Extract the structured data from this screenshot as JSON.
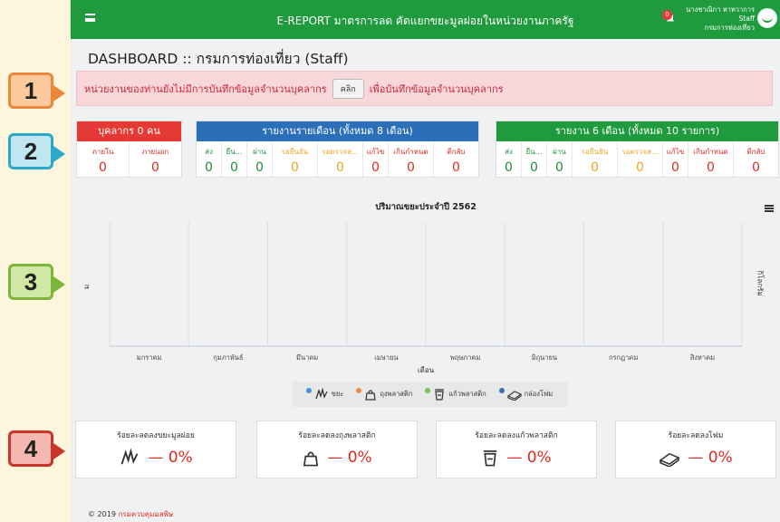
{
  "callouts": [
    "1",
    "2",
    "3",
    "4"
  ],
  "header": {
    "title": "E-REPORT มาตรการลด คัดแยกขยะมูลฝอยในหน่วยงานภาครัฐ",
    "notification_count": "0",
    "user_name": "นางชาณิกา หาทวาการ",
    "user_role": "Staff",
    "user_org": "กรมการท่องเที่ยว"
  },
  "page_title": "DASHBOARD :: กรมการท่องเที่ยว (Staff)",
  "alert": {
    "text_before": "หน่วยงานของท่านยังไม่มีการบันทึกข้อมูลจำนวนบุคลากร",
    "button_label": "คลิก",
    "text_after": "เพื่อบันทึกข้อมูลจำนวนบุคลากร"
  },
  "personnel": {
    "title": "บุคลากร 0 คน",
    "color": "#e53935",
    "cols": [
      {
        "label": "ภายใน",
        "value": "0"
      },
      {
        "label": "ภายนอก",
        "value": "0"
      }
    ]
  },
  "monthly": {
    "title": "รายงานรายเดือน (ทั้งหมด 8 เดือน)",
    "color": "#2b6fb8",
    "cols": [
      {
        "label": "ส่ง",
        "value": "0",
        "c": "gr"
      },
      {
        "label": "ยืน...",
        "value": "0",
        "c": "gr"
      },
      {
        "label": "ผ่าน",
        "value": "0",
        "c": "gr"
      },
      {
        "label": "รอยืนยัน",
        "value": "0",
        "c": "or"
      },
      {
        "label": "รอตรวจส...",
        "value": "0",
        "c": "or"
      },
      {
        "label": "แก้ไข",
        "value": "0",
        "c": "red"
      },
      {
        "label": "เกินกำหนด",
        "value": "0",
        "c": "red"
      },
      {
        "label": "ตีกลับ",
        "value": "0",
        "c": "red"
      }
    ]
  },
  "six_month": {
    "title": "รายงาน 6 เดือน (ทั้งหมด 10 รายการ)",
    "color": "#1f9b3d",
    "cols": [
      {
        "label": "ส่ง",
        "value": "0",
        "c": "gr"
      },
      {
        "label": "ยืน...",
        "value": "0",
        "c": "gr"
      },
      {
        "label": "ผ่าน",
        "value": "0",
        "c": "gr"
      },
      {
        "label": "รอยืนยัน",
        "value": "0",
        "c": "or"
      },
      {
        "label": "รอตรวจส...",
        "value": "0",
        "c": "or"
      },
      {
        "label": "แก้ไข",
        "value": "0",
        "c": "red"
      },
      {
        "label": "เกินกำหนด",
        "value": "0",
        "c": "red"
      },
      {
        "label": "ตีกลับ",
        "value": "0",
        "c": "red"
      }
    ]
  },
  "chart_data": {
    "type": "bar",
    "title": "ปริมาณขยะประจำปี 2562",
    "xlabel": "เดือน",
    "ylabel_left": "ม",
    "ylabel_right": "กิโลกรัม",
    "categories": [
      "มกราคม",
      "กุมภาพันธ์",
      "มีนาคม",
      "เมษายน",
      "พฤษภาคม",
      "มิถุนายน",
      "กรกฎาคม",
      "สิงหาคม"
    ],
    "series": [
      {
        "name": "ขยะ",
        "color": "#4c90d6",
        "values": []
      },
      {
        "name": "ถุงพลาสติก",
        "color": "#f0883e",
        "values": []
      },
      {
        "name": "แก้วพลาสติก",
        "color": "#7cc35a",
        "values": []
      },
      {
        "name": "กล่องโฟม",
        "color": "#3f6fb0",
        "values": []
      }
    ],
    "grid": true,
    "legend": "bottom"
  },
  "reduction": [
    {
      "title": "ร้อยละลดลงขยะมูลฝอย",
      "value": "— 0%",
      "icon": "waste-icon"
    },
    {
      "title": "ร้อยละลดลงถุงพลาสติก",
      "value": "— 0%",
      "icon": "plastic-bag-icon"
    },
    {
      "title": "ร้อยละลดลงแก้วพลาสติก",
      "value": "— 0%",
      "icon": "plastic-cup-icon"
    },
    {
      "title": "ร้อยละลดลงโฟม",
      "value": "— 0%",
      "icon": "foam-box-icon"
    }
  ],
  "footer": {
    "year": "© 2019",
    "org": "กรมควบคุมมลพิษ"
  }
}
